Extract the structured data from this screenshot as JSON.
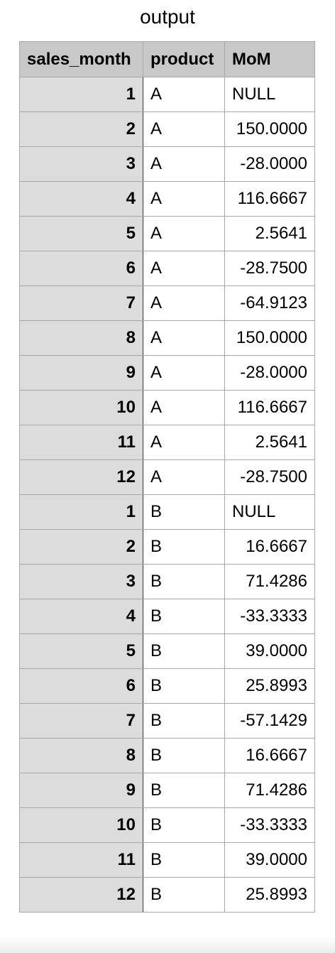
{
  "caption": "output",
  "table": {
    "columns": [
      "sales_month",
      "product",
      "MoM"
    ],
    "rows": [
      {
        "sales_month": "1",
        "product": "A",
        "MoM": "NULL"
      },
      {
        "sales_month": "2",
        "product": "A",
        "MoM": "150.0000"
      },
      {
        "sales_month": "3",
        "product": "A",
        "MoM": "-28.0000"
      },
      {
        "sales_month": "4",
        "product": "A",
        "MoM": "116.6667"
      },
      {
        "sales_month": "5",
        "product": "A",
        "MoM": "2.5641"
      },
      {
        "sales_month": "6",
        "product": "A",
        "MoM": "-28.7500"
      },
      {
        "sales_month": "7",
        "product": "A",
        "MoM": "-64.9123"
      },
      {
        "sales_month": "8",
        "product": "A",
        "MoM": "150.0000"
      },
      {
        "sales_month": "9",
        "product": "A",
        "MoM": "-28.0000"
      },
      {
        "sales_month": "10",
        "product": "A",
        "MoM": "116.6667"
      },
      {
        "sales_month": "11",
        "product": "A",
        "MoM": "2.5641"
      },
      {
        "sales_month": "12",
        "product": "A",
        "MoM": "-28.7500"
      },
      {
        "sales_month": "1",
        "product": "B",
        "MoM": "NULL"
      },
      {
        "sales_month": "2",
        "product": "B",
        "MoM": "16.6667"
      },
      {
        "sales_month": "3",
        "product": "B",
        "MoM": "71.4286"
      },
      {
        "sales_month": "4",
        "product": "B",
        "MoM": "-33.3333"
      },
      {
        "sales_month": "5",
        "product": "B",
        "MoM": "39.0000"
      },
      {
        "sales_month": "6",
        "product": "B",
        "MoM": "25.8993"
      },
      {
        "sales_month": "7",
        "product": "B",
        "MoM": "-57.1429"
      },
      {
        "sales_month": "8",
        "product": "B",
        "MoM": "16.6667"
      },
      {
        "sales_month": "9",
        "product": "B",
        "MoM": "71.4286"
      },
      {
        "sales_month": "10",
        "product": "B",
        "MoM": "-33.3333"
      },
      {
        "sales_month": "11",
        "product": "B",
        "MoM": "39.0000"
      },
      {
        "sales_month": "12",
        "product": "B",
        "MoM": "25.8993"
      }
    ]
  },
  "colors": {
    "header_bg": "#c8c8c8",
    "month_col_bg": "#dcdcdc",
    "grid_line": "#a8a8a8"
  }
}
